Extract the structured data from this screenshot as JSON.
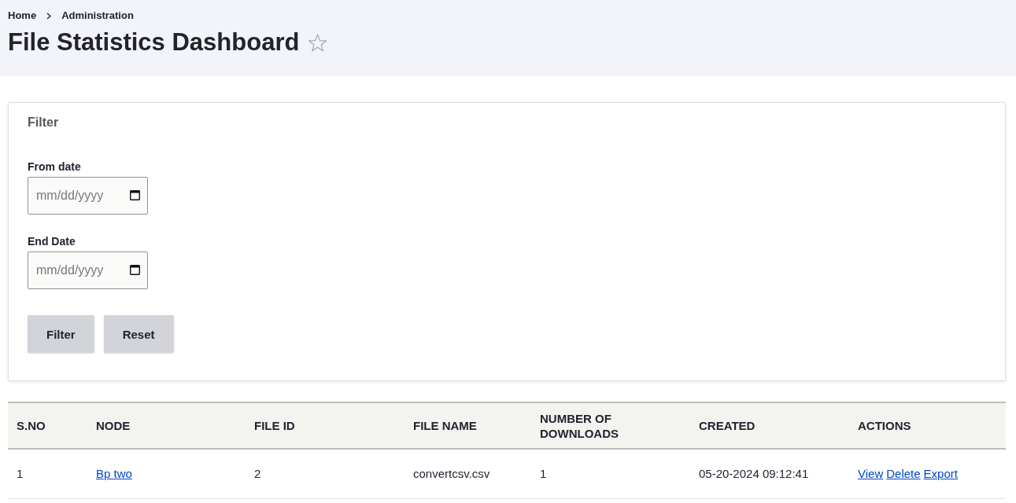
{
  "breadcrumb": [
    {
      "label": "Home"
    },
    {
      "label": "Administration"
    }
  ],
  "page": {
    "title": "File Statistics Dashboard",
    "favorite": false
  },
  "filter": {
    "legend": "Filter",
    "fields": [
      {
        "label": "From date",
        "placeholder": "mm/dd/yyyy"
      },
      {
        "label": "End Date",
        "placeholder": "mm/dd/yyyy"
      }
    ],
    "buttons": [
      {
        "label": "Filter"
      },
      {
        "label": "Reset"
      }
    ]
  },
  "table": {
    "columns": [
      "S.NO",
      "NODE",
      "FILE ID",
      "FILE NAME",
      "NUMBER OF DOWNLOADS",
      "CREATED",
      "ACTIONS"
    ],
    "rows": [
      {
        "cells": [
          {
            "kind": "text",
            "text": "1"
          },
          {
            "kind": "link",
            "text": "Bp two"
          },
          {
            "kind": "text",
            "text": "2"
          },
          {
            "kind": "text",
            "text": "convertcsv.csv"
          },
          {
            "kind": "text",
            "text": "1"
          },
          {
            "kind": "text",
            "text": "05-20-2024 09:12:41"
          },
          {
            "kind": "links",
            "links": [
              "View",
              "Delete",
              "Export"
            ]
          }
        ]
      }
    ]
  }
}
